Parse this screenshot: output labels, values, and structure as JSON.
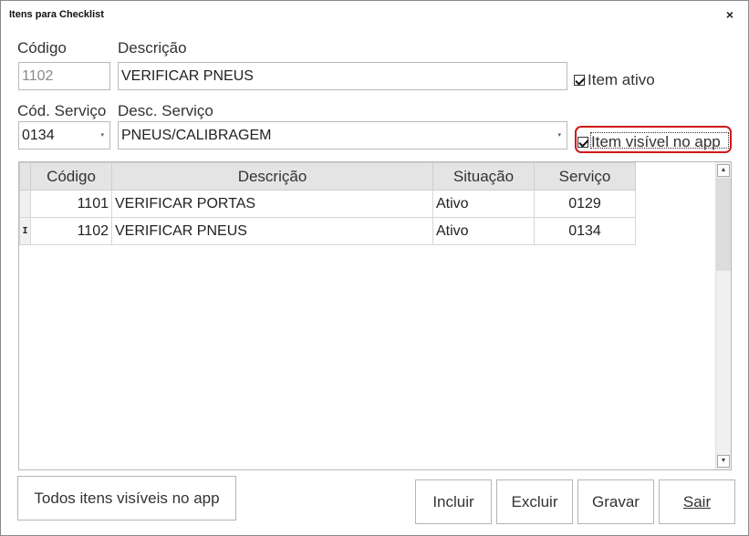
{
  "window": {
    "title": "Itens para Checklist",
    "close_glyph": "×"
  },
  "form": {
    "codigo_label": "Código",
    "codigo_value": "1102",
    "descricao_label": "Descrição",
    "descricao_value": "VERIFICAR PNEUS",
    "item_ativo_label": "Item ativo",
    "item_ativo_checked": true,
    "cod_servico_label": "Cód. Serviço",
    "cod_servico_value": "0134",
    "desc_servico_label": "Desc. Serviço",
    "desc_servico_value": "PNEUS/CALIBRAGEM",
    "item_visivel_label": "Item visível no app",
    "item_visivel_checked": true,
    "dropdown_glyph": "▾"
  },
  "grid": {
    "columns": [
      "Código",
      "Descrição",
      "Situação",
      "Serviço"
    ],
    "rows": [
      {
        "indicator": "",
        "codigo": "1101",
        "descricao": "VERIFICAR PORTAS",
        "situacao": "Ativo",
        "servico": "0129"
      },
      {
        "indicator": "I",
        "codigo": "1102",
        "descricao": "VERIFICAR PNEUS",
        "situacao": "Ativo",
        "servico": "0134"
      }
    ],
    "scroll_up_glyph": "▲",
    "scroll_down_glyph": "▼"
  },
  "buttons": {
    "todos_visiveis": "Todos itens visíveis no app",
    "incluir": "Incluir",
    "excluir": "Excluir",
    "gravar": "Gravar",
    "sair": "Sair"
  },
  "colors": {
    "focus_ring": "#d01818",
    "header_bg": "#e4e4e4"
  }
}
